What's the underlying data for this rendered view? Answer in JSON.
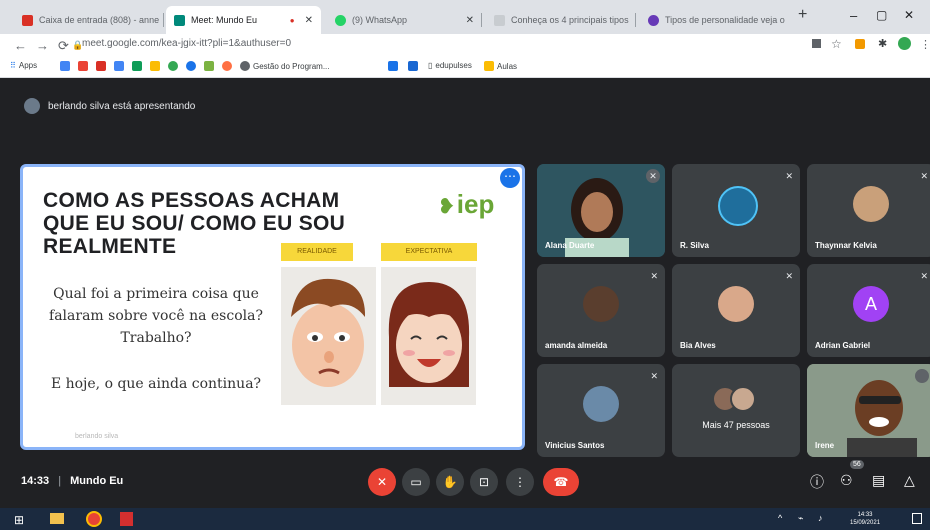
{
  "browser": {
    "tabs": [
      {
        "label": "Caixa de entrada (808) - anne",
        "color": "#d93025",
        "active": false
      },
      {
        "label": "Meet: Mundo Eu",
        "color": "#00897b",
        "active": true
      },
      {
        "label": "(9) WhatsApp",
        "color": "#25d366",
        "active": false
      },
      {
        "label": "Conheça os 4 principais tipos",
        "color": "#9aa0a6",
        "active": false
      },
      {
        "label": "Tipos de personalidade veja o",
        "color": "#673ab7",
        "active": false
      }
    ],
    "new_tab": "+",
    "window": {
      "minimize": "–",
      "maximize": "▢",
      "close": "✕"
    },
    "url": "meet.google.com/kea-jgix-itt?pli=1&authuser=0",
    "nav": {
      "back": "←",
      "forward": "→",
      "reload": "⟳"
    },
    "bookmarks": [
      "Apps",
      "Gestão do Program...",
      "edupulses",
      "Aulas"
    ]
  },
  "meet": {
    "presenting_text": "berlando silva está apresentando",
    "slide": {
      "title": "COMO AS PESSOAS ACHAM QUE EU SOU/ COMO EU SOU REALMENTE",
      "logo": "iep",
      "tag_left": "REALIDADE",
      "tag_right": "EXPECTATIVA",
      "question1": "Qual foi a primeira coisa que falaram sobre você na escola? Trabalho?",
      "question2": "E hoje, o que ainda continua?",
      "watermark": "berlando silva"
    },
    "participants": [
      {
        "name": "Alana Duarte",
        "bg": "#2d4a54",
        "kind": "video",
        "muted": true
      },
      {
        "name": "R. Silva",
        "bg": "#3c4043",
        "kind": "logo",
        "muted": true
      },
      {
        "name": "Thaynnar Kelvia",
        "bg": "#3c4043",
        "kind": "photo",
        "muted": true
      },
      {
        "name": "amanda almeida",
        "bg": "#3c4043",
        "kind": "photo",
        "muted": true
      },
      {
        "name": "Bia Alves",
        "bg": "#3c4043",
        "kind": "photo",
        "muted": true
      },
      {
        "name": "Adrian Gabriel",
        "bg": "#3c4043",
        "kind": "initial",
        "initial": "A",
        "muted": true
      },
      {
        "name": "Vinicius Santos",
        "bg": "#3c4043",
        "kind": "photo",
        "muted": true
      },
      {
        "name": "Mais 47 pessoas",
        "bg": "#3c4043",
        "kind": "more",
        "muted": false
      },
      {
        "name": "Irene",
        "bg": "#7a8a7a",
        "kind": "video",
        "muted": false
      }
    ],
    "time": "14:33",
    "meeting_name": "Mundo Eu",
    "people_count": "56",
    "colors": {
      "accent": "#8ab4f8",
      "danger": "#ea4335",
      "bg": "#202124"
    }
  },
  "taskbar": {
    "clock_time": "14:33",
    "clock_date": "15/09/2021"
  }
}
